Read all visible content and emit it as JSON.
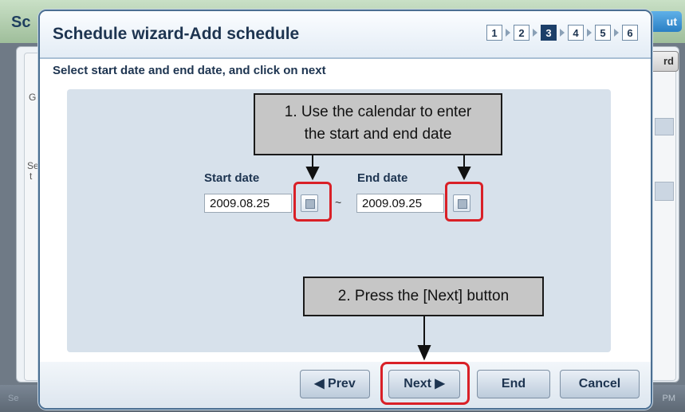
{
  "background": {
    "title": "Sc",
    "top_button": "ut",
    "right_button": "rd",
    "side_text_1": "G",
    "side_text_2": "Se",
    "side_text_3": "t",
    "footer_left": "Se",
    "footer_right": "PM"
  },
  "dialog": {
    "title": "Schedule wizard-Add schedule",
    "steps": [
      "1",
      "2",
      "3",
      "4",
      "5",
      "6"
    ],
    "active_step": "3",
    "instruction": "Select start date and end date, and click on next"
  },
  "form": {
    "start_label": "Start date",
    "start_value": "2009.08.25",
    "separator": "~",
    "end_label": "End date",
    "end_value": "2009.09.25"
  },
  "callouts": {
    "calendar_line1": "1. Use the calendar to enter",
    "calendar_line2": "the start and end date",
    "next": "2. Press the [Next] button"
  },
  "buttons": {
    "prev": "◀ Prev",
    "next": "Next ▶",
    "end": "End",
    "cancel": "Cancel"
  },
  "colors": {
    "highlight": "#d92027",
    "active_step": "#1c3f69"
  },
  "icons": [
    "calendar-icon",
    "calendar-icon"
  ]
}
